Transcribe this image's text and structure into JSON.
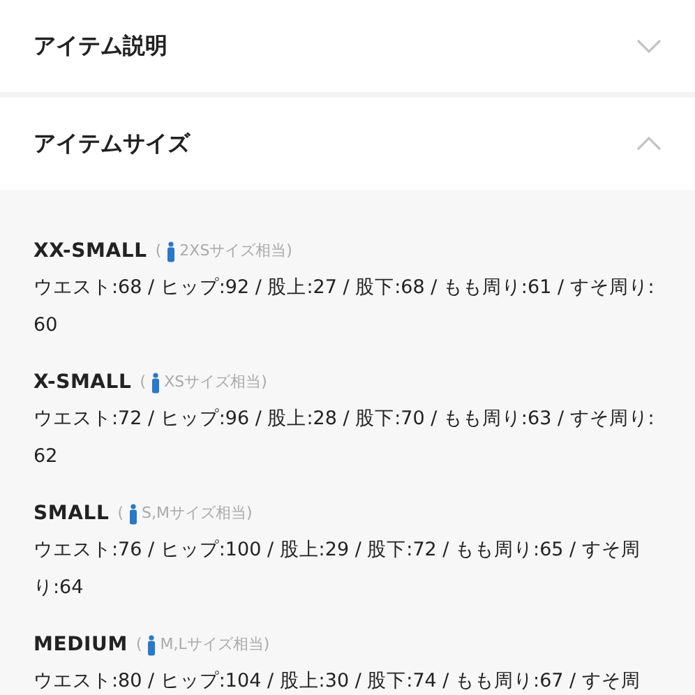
{
  "sections": [
    {
      "title": "アイテム説明",
      "expanded": false
    },
    {
      "title": "アイテムサイズ",
      "expanded": true
    }
  ],
  "sizes": [
    {
      "name": "XX-SMALL",
      "note_prefix": "(",
      "note": "2XSサイズ相当)",
      "measurements": "ウエスト:68 / ヒップ:92 / 股上:27 / 股下:68 / もも周り:61 / すそ周り:60"
    },
    {
      "name": "X-SMALL",
      "note_prefix": "(",
      "note": "XSサイズ相当)",
      "measurements": "ウエスト:72 / ヒップ:96 / 股上:28 / 股下:70 / もも周り:63 / すそ周り:62"
    },
    {
      "name": "SMALL",
      "note_prefix": "(",
      "note": "S,Mサイズ相当)",
      "measurements": "ウエスト:76 / ヒップ:100 / 股上:29 / 股下:72 / もも周り:65 / すそ周り:64"
    },
    {
      "name": "MEDIUM",
      "note_prefix": "(",
      "note": "M,Lサイズ相当)",
      "measurements": "ウエスト:80 / ヒップ:104 / 股上:30 / 股下:74 / もも周り:67 / すそ周"
    }
  ]
}
